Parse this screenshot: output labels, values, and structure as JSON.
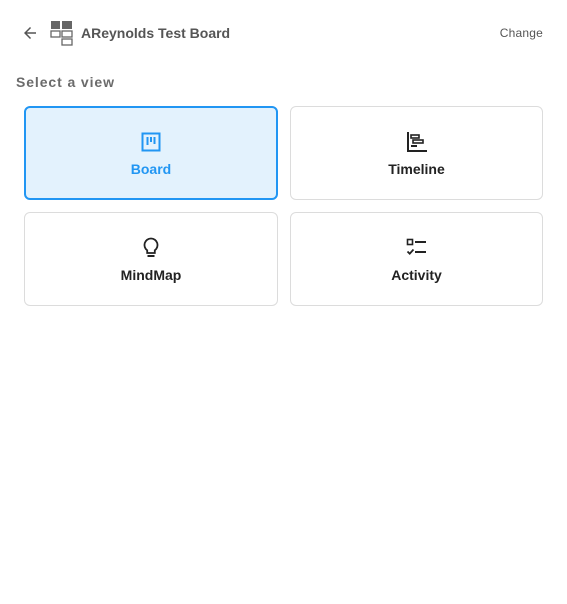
{
  "header": {
    "back_icon": "arrow-left-icon",
    "board_icon": "board-layout-icon",
    "board_title": "AReynolds Test Board",
    "change_label": "Change"
  },
  "section": {
    "label": "Select a view"
  },
  "views": [
    {
      "label": "Board",
      "icon": "board-icon",
      "selected": true
    },
    {
      "label": "Timeline",
      "icon": "timeline-icon",
      "selected": false
    },
    {
      "label": "MindMap",
      "icon": "lightbulb-icon",
      "selected": false
    },
    {
      "label": "Activity",
      "icon": "checklist-icon",
      "selected": false
    }
  ],
  "colors": {
    "accent": "#2196f3",
    "selected_bg": "#e3f2fd",
    "text_dark": "#222222",
    "text_muted": "#555555",
    "border": "#dcdcdc"
  }
}
